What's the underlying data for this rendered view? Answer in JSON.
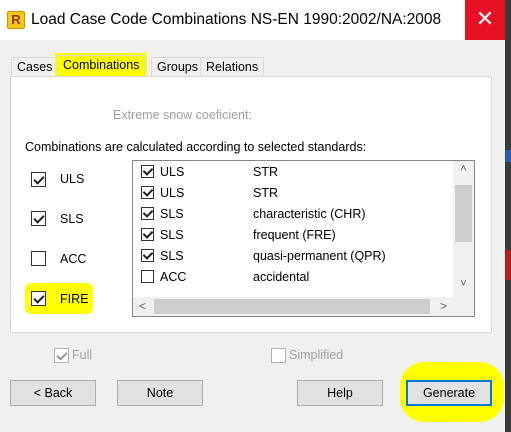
{
  "window": {
    "app_icon": "R",
    "title": "Load Case Code Combinations NS-EN 1990:2002/NA:2008",
    "close_glyph": "✕"
  },
  "tabs": [
    {
      "label": "Cases"
    },
    {
      "label": "Combinations",
      "active": true
    },
    {
      "label": "Groups"
    },
    {
      "label": "Relations"
    }
  ],
  "panel": {
    "snow_label": "Extreme snow coeficient:",
    "calc_label": "Combinations are calculated according to selected standards:",
    "limit_states": [
      {
        "label": "ULS",
        "checked": true
      },
      {
        "label": "SLS",
        "checked": true
      },
      {
        "label": "ACC",
        "checked": false
      },
      {
        "label": "FIRE",
        "checked": true
      }
    ],
    "combination_list": [
      {
        "checked": true,
        "state": "ULS",
        "type": "STR"
      },
      {
        "checked": true,
        "state": "ULS",
        "type": "STR"
      },
      {
        "checked": true,
        "state": "SLS",
        "type": "characteristic (CHR)"
      },
      {
        "checked": true,
        "state": "SLS",
        "type": "frequent (FRE)"
      },
      {
        "checked": true,
        "state": "SLS",
        "type": "quasi-permanent (QPR)"
      },
      {
        "checked": false,
        "state": "ACC",
        "type": "accidental"
      }
    ]
  },
  "options": {
    "full": {
      "label": "Full",
      "checked": true,
      "enabled": false
    },
    "simplified": {
      "label": "Simplified",
      "checked": false,
      "enabled": false
    }
  },
  "buttons": {
    "back": "< Back",
    "note": "Note",
    "help": "Help",
    "generate": "Generate"
  },
  "colors": {
    "highlight": "#ffff00",
    "close_red": "#e81123",
    "default_button_border": "#0078d7"
  }
}
